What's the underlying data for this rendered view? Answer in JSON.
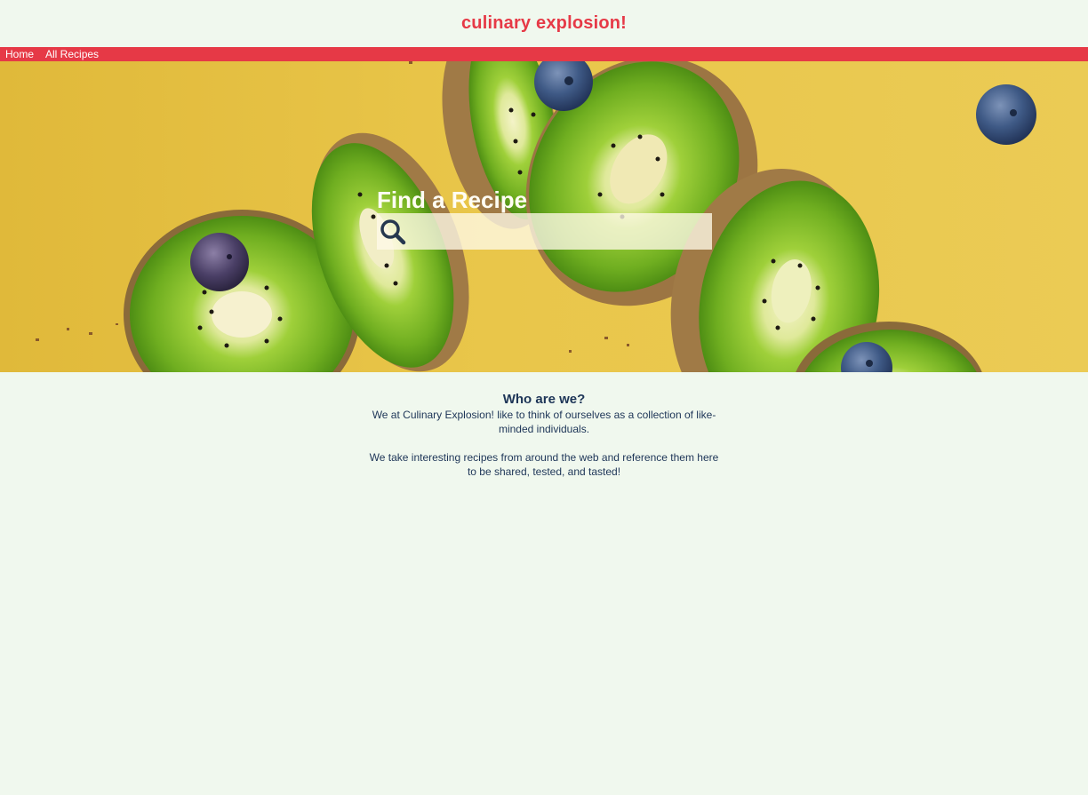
{
  "header": {
    "title": "culinary explosion!"
  },
  "nav": {
    "items": [
      {
        "label": "Home"
      },
      {
        "label": "All Recipes"
      }
    ]
  },
  "hero": {
    "background_description_color": "#e9c64a",
    "search": {
      "heading": "Find a Recipe",
      "placeholder": "",
      "value": "",
      "icon": "search-icon"
    }
  },
  "about": {
    "heading": "Who are we?",
    "paragraphs": [
      "We at Culinary Explosion! like to think of ourselves as a collection of like-minded individuals.",
      "We take interesting recipes from around the web and reference them here to be shared, tested, and tasted!"
    ]
  },
  "colors": {
    "brand": "#e63946",
    "background": "#f0f8ee",
    "text": "#1d3557",
    "hero_yellow": "#e9c64a"
  }
}
